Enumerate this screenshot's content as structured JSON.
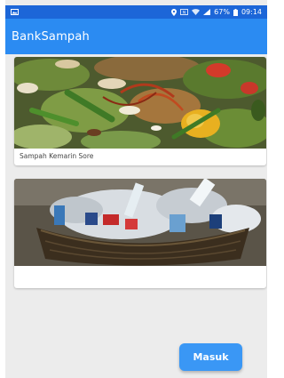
{
  "status_bar": {
    "time": "09:14",
    "battery_percent": "67%",
    "icons": [
      "image-notification-icon",
      "location-icon",
      "nfc-icon",
      "wifi-icon",
      "signal-icon",
      "battery-icon"
    ]
  },
  "app_bar": {
    "title": "BankSampah",
    "background": "#2b8bf2"
  },
  "cards": [
    {
      "caption": "Sampah Kemarin Sore",
      "image": "food-waste-photo"
    },
    {
      "caption": "",
      "image": "trash-basket-photo"
    }
  ],
  "actions": {
    "masuk_label": "Masuk"
  },
  "colors": {
    "status_bar": "#1c66d8",
    "accent": "#2b8bf2",
    "button": "#3a97f5"
  }
}
